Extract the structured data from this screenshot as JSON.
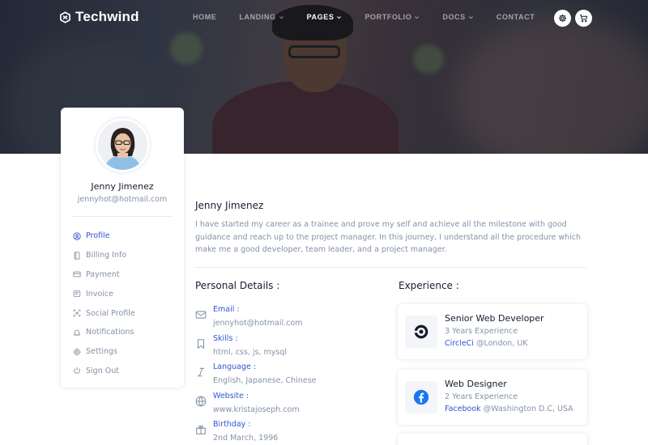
{
  "brand": {
    "name": "Techwind",
    "accent": "#2f55d4",
    "muted": "#8492a6",
    "dark": "#161c2d"
  },
  "nav": {
    "items": [
      {
        "label": "HOME",
        "dropdown": false,
        "active": false
      },
      {
        "label": "LANDING",
        "dropdown": true,
        "active": false
      },
      {
        "label": "PAGES",
        "dropdown": true,
        "active": true
      },
      {
        "label": "PORTFOLIO",
        "dropdown": true,
        "active": false
      },
      {
        "label": "DOCS",
        "dropdown": true,
        "active": false
      },
      {
        "label": "CONTACT",
        "dropdown": false,
        "active": false
      }
    ],
    "buttons": [
      {
        "icon": "gear-icon"
      },
      {
        "icon": "cart-icon"
      }
    ]
  },
  "sidebar": {
    "name": "Jenny Jimenez",
    "email": "jennyhot@hotmail.com",
    "menu": [
      {
        "label": "Profile",
        "icon": "user-circle-icon",
        "active": true
      },
      {
        "label": "Billing Info",
        "icon": "file-icon",
        "active": false
      },
      {
        "label": "Payment",
        "icon": "credit-card-icon",
        "active": false
      },
      {
        "label": "Invoice",
        "icon": "invoice-icon",
        "active": false
      },
      {
        "label": "Social Profile",
        "icon": "share-icon",
        "active": false
      },
      {
        "label": "Notifications",
        "icon": "bell-icon",
        "active": false
      },
      {
        "label": "Settings",
        "icon": "gear-icon",
        "active": false
      },
      {
        "label": "Sign Out",
        "icon": "power-icon",
        "active": false
      }
    ]
  },
  "main": {
    "name": "Jenny Jimenez",
    "bio": "I have started my career as a trainee and prove my self and achieve all the milestone with good guidance and reach up to the project manager. In this journey, I understand all the procedure which make me a good developer, team leader, and a project manager.",
    "personal_title": "Personal Details :",
    "experience_title": "Experience :",
    "details": [
      {
        "label": "Email :",
        "values": [
          "jennyhot@hotmail.com"
        ],
        "icon": "mail-icon"
      },
      {
        "label": "Skills :",
        "values": [
          "html",
          "css",
          "js",
          "mysql"
        ],
        "icon": "bookmark-icon"
      },
      {
        "label": "Language :",
        "values": [
          "English",
          "Japanese",
          "Chinese"
        ],
        "icon": "italic-icon"
      },
      {
        "label": "Website :",
        "values": [
          "www.kristajoseph.com"
        ],
        "icon": "globe-icon"
      },
      {
        "label": "Birthday :",
        "values": [
          "2nd March, 1996"
        ],
        "icon": "gift-icon"
      }
    ],
    "experience": [
      {
        "title": "Senior Web Developer",
        "duration": "3 Years Experience",
        "company": "CircleCi",
        "location": "@London, UK",
        "logo": "circleci-logo"
      },
      {
        "title": "Web Designer",
        "duration": "2 Years Experience",
        "company": "Facebook",
        "location": "@Washington D.C, USA",
        "logo": "facebook-logo"
      }
    ]
  }
}
